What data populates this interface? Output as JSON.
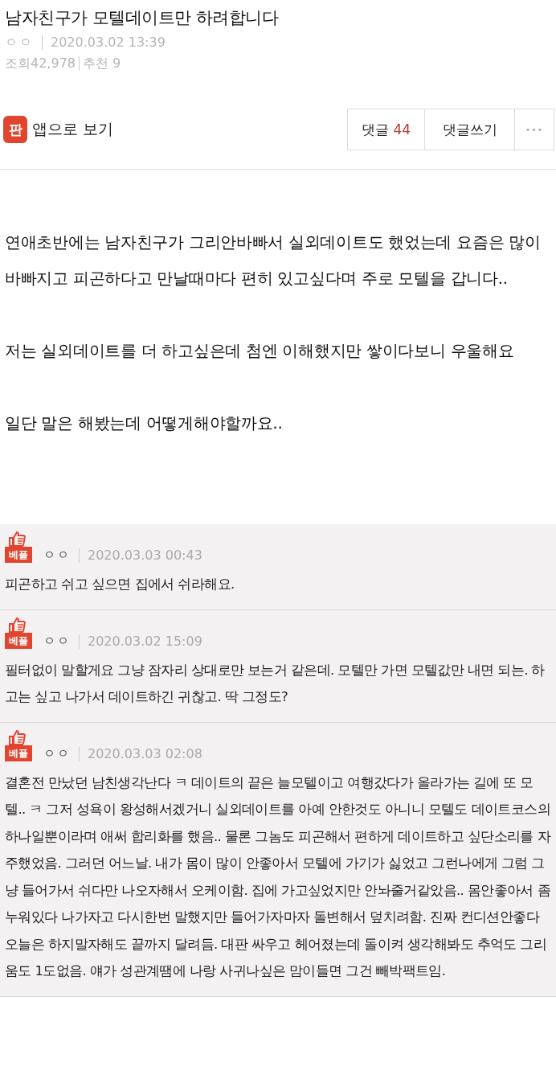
{
  "post": {
    "title": "남자친구가 모텔데이트만 하려합니다",
    "author": "ㅇㅇ",
    "date": "2020.03.02 13:39",
    "views_label": "조회",
    "views": "42,978",
    "recommend_label": "추천",
    "recommend": "9"
  },
  "toolbar": {
    "app_logo": "판",
    "app_link": "앱으로 보기",
    "comments_label": "댓글",
    "comments_count": "44",
    "write_comment": "댓글쓰기",
    "more": "•••"
  },
  "body": [
    "연애초반에는 남자친구가 그리안바빠서 실외데이트도 했었는데 요즘은 많이 바빠지고 피곤하다고 만날때마다 편히 있고싶다며 주로 모텔을 갑니다..",
    "저는 실외데이트를 더 하고싶은데 첨엔 이해했지만 쌓이다보니 우울해요",
    "일단 말은 해봤는데 어떻게해야할까요.."
  ],
  "comments": [
    {
      "badge": "베플",
      "author": "ㅇㅇ",
      "date": "2020.03.03 00:43",
      "text": "피곤하고 쉬고 싶으면 집에서 쉬라해요."
    },
    {
      "badge": "베플",
      "author": "ㅇㅇ",
      "date": "2020.03.02 15:09",
      "text": "필터없이 말할게요 그냥 잠자리 상대로만 보는거 같은데. 모텔만 가면 모텔값만 내면 되는. 하고는 싶고 나가서 데이트하긴 귀찮고. 딱 그정도?"
    },
    {
      "badge": "베플",
      "author": "ㅇㅇ",
      "date": "2020.03.03 02:08",
      "text": "결혼전 만났던 남친생각난다 ㅋ 데이트의 끝은 늘모텔이고 여행갔다가 올라가는 길에 또 모텔.. ㅋ 그저 성욕이 왕성해서겠거니 실외데이트를 아예 안한것도 아니니 모텔도 데이트코스의 하나일뿐이라며 애써 합리화를 했음.. 물론 그놈도 피곤해서 편하게 데이트하고 싶단소리를 자주했었음. 그러던 어느날. 내가 몸이 많이 안좋아서 모텔에 가기가 싫었고 그런나에게 그럼 그냥 들어가서 쉬다만 나오자해서 오케이함. 집에 가고싶었지만 안놔줄거같았음.. 몸안좋아서 좀누워있다 나가자고 다시한번 말했지만 들어가자마자 돌변해서 덮치려함. 진짜 컨디션안좋다 오늘은 하지말자해도 끝까지 달려듬. 대판 싸우고 헤어졌는데 돌이켜 생각해봐도 추억도 그리움도 1도없음. 얘가 성관계땜에 나랑 사귀나싶은 맘이들면 그건 빼박팩트임."
    }
  ]
}
